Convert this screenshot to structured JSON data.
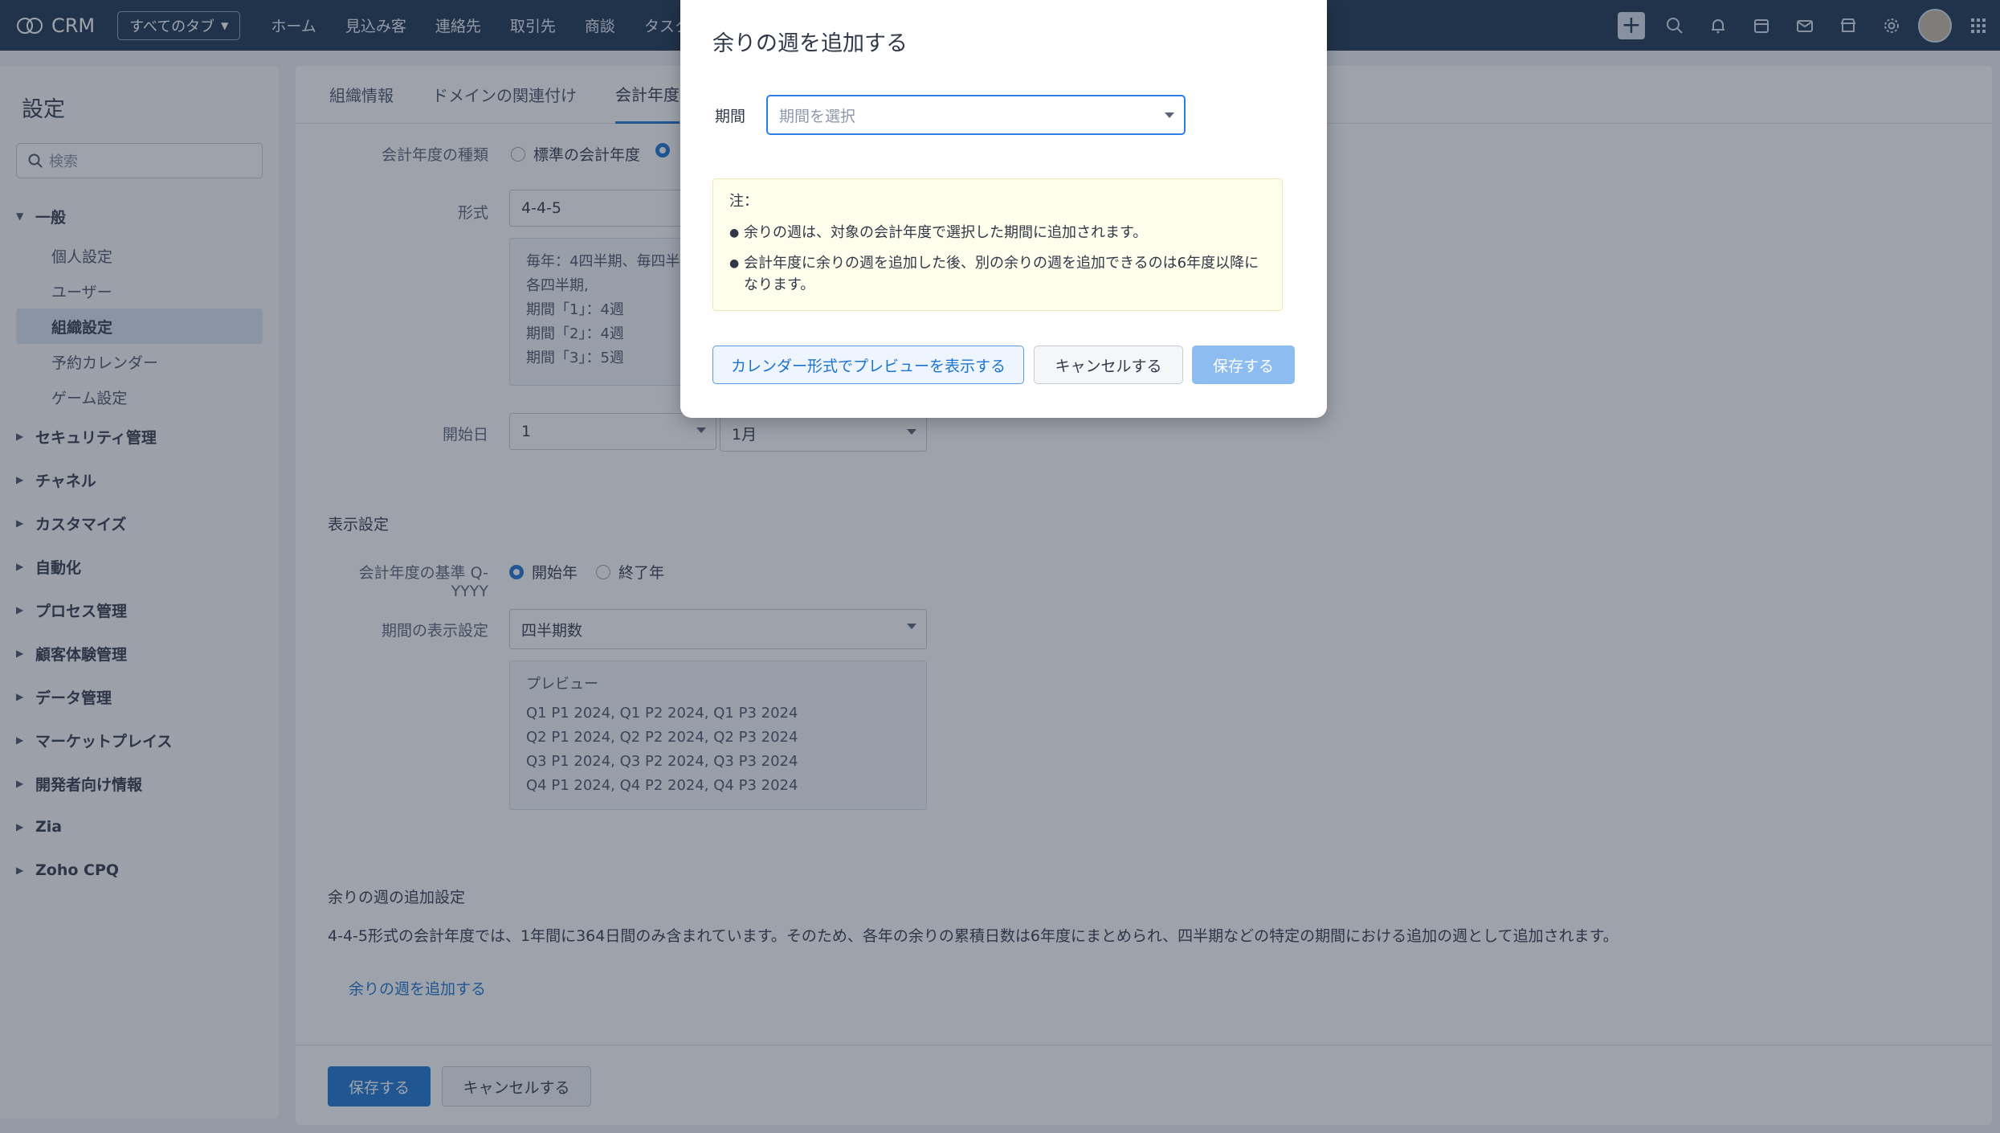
{
  "app": {
    "logo_text": "CRM",
    "tabs_dropdown": "すべてのタブ",
    "nav": [
      "ホーム",
      "見込み客",
      "連絡先",
      "取引先",
      "商談",
      "タスク"
    ]
  },
  "top_icons": [
    "plus-icon",
    "search-icon",
    "bell-icon",
    "calendar-icon",
    "mail-icon",
    "store-icon",
    "gear-icon",
    "avatar",
    "apps-grid-icon"
  ],
  "sidebar": {
    "title": "設定",
    "search_placeholder": "検索",
    "general": {
      "label": "一般",
      "items": [
        {
          "label": "個人設定",
          "active": false
        },
        {
          "label": "ユーザー",
          "active": false
        },
        {
          "label": "組織設定",
          "active": true
        },
        {
          "label": "予約カレンダー",
          "active": false
        },
        {
          "label": "ゲーム設定",
          "active": false
        }
      ]
    },
    "groups": [
      "セキュリティ管理",
      "チャネル",
      "カスタマイズ",
      "自動化",
      "プロセス管理",
      "顧客体験管理",
      "データ管理",
      "マーケットプレイス",
      "開発者向け情報",
      "Zia",
      "Zoho CPQ"
    ]
  },
  "main": {
    "tabs": [
      "組織情報",
      "ドメインの関連付け",
      "会計年度"
    ],
    "fiscal_type_label": "会計年度の種類",
    "fiscal_type_standard": "標準の会計年度",
    "format_label": "形式",
    "format_value": "4-4-5",
    "format_info": [
      "毎年：4四半期、毎四半期",
      "各四半期,",
      "期間「1」：4週",
      "期間「2」：4週",
      "期間「3」：5週"
    ],
    "start_label": "開始日",
    "start_day": "1",
    "start_month": "1月",
    "display_section": "表示設定",
    "basis_label": "会計年度の基準 Q-YYYY",
    "basis_start": "開始年",
    "basis_end": "終了年",
    "period_display_label": "期間の表示設定",
    "period_display_value": "四半期数",
    "preview_title": "プレビュー",
    "preview_lines": [
      "Q1 P1 2024, Q1 P2 2024, Q1 P3 2024",
      "Q2 P1 2024, Q2 P2 2024, Q2 P3 2024",
      "Q3 P1 2024, Q3 P2 2024, Q3 P3 2024",
      "Q4 P1 2024, Q4 P2 2024, Q4 P3 2024"
    ],
    "extra_section": "余りの週の追加設定",
    "extra_desc": "4-4-5形式の会計年度では、1年間に364日間のみ含まれています。そのため、各年の余りの累積日数は6年度にまとめられ、四半期などの特定の期間における追加の週として追加されます。",
    "extra_link": "余りの週を追加する",
    "save": "保存する",
    "cancel": "キャンセルする"
  },
  "modal": {
    "title": "余りの週を追加する",
    "period_label": "期間",
    "period_placeholder": "期間を選択",
    "note_title": "注：",
    "notes": [
      "余りの週は、対象の会計年度で選択した期間に追加されます。",
      "会計年度に余りの週を追加した後、別の余りの週を追加できるのは6年度以降になります。"
    ],
    "preview_button": "カレンダー形式でプレビューを表示する",
    "cancel_button": "キャンセルする",
    "save_button": "保存する"
  },
  "colors": {
    "topbar": "#1d3350",
    "accent": "#1b73d1",
    "note_bg": "#fffdeb"
  }
}
